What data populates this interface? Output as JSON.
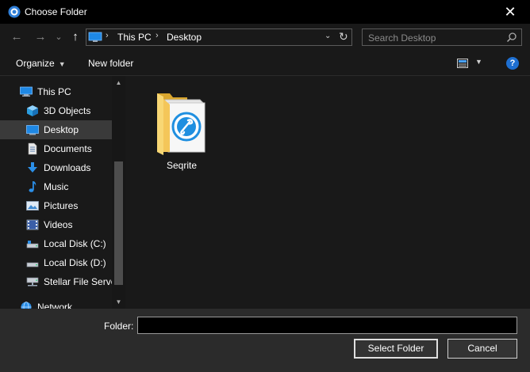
{
  "window": {
    "title": "Choose Folder",
    "close_glyph": "✕"
  },
  "navigation": {
    "back_glyph": "←",
    "forward_glyph": "→",
    "recent_glyph": "⌄",
    "up_glyph": "↑",
    "address": {
      "crumbs": [
        "This PC",
        "Desktop"
      ],
      "separator": "›",
      "dropdown_glyph": "⌄",
      "refresh_glyph": "↻"
    },
    "search": {
      "placeholder": "Search Desktop"
    }
  },
  "toolbar": {
    "organize_label": "Organize",
    "caret_glyph": "▼",
    "new_folder_label": "New folder",
    "help_glyph": "?"
  },
  "sidebar": {
    "items": [
      {
        "label": "This PC",
        "icon": "this-pc-icon"
      },
      {
        "label": "3D Objects",
        "icon": "3d-objects-icon"
      },
      {
        "label": "Desktop",
        "icon": "desktop-icon",
        "selected": true
      },
      {
        "label": "Documents",
        "icon": "documents-icon"
      },
      {
        "label": "Downloads",
        "icon": "downloads-icon"
      },
      {
        "label": "Music",
        "icon": "music-icon"
      },
      {
        "label": "Pictures",
        "icon": "pictures-icon"
      },
      {
        "label": "Videos",
        "icon": "videos-icon"
      },
      {
        "label": "Local Disk (C:)",
        "icon": "local-disk-icon"
      },
      {
        "label": "Local Disk (D:)",
        "icon": "local-disk-icon"
      },
      {
        "label": "Stellar File Server",
        "icon": "network-drive-icon"
      },
      {
        "label": "Network",
        "icon": "network-icon"
      }
    ],
    "scroll_up_glyph": "▲",
    "scroll_down_glyph": "▼"
  },
  "content": {
    "items": [
      {
        "name": "Seqrite",
        "icon": "folder-icon"
      }
    ]
  },
  "footer": {
    "folder_label": "Folder:",
    "folder_value": "",
    "select_button": "Select Folder",
    "cancel_button": "Cancel"
  },
  "colors": {
    "accent_blue": "#1e6fd1",
    "folder_yellow": "#f4c659",
    "background": "#191919"
  }
}
